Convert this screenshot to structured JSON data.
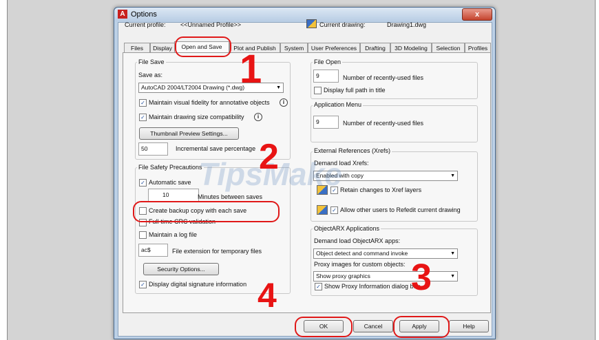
{
  "window": {
    "title": "Options",
    "close": "x"
  },
  "header": {
    "current_profile_label": "Current profile:",
    "current_profile_value": "<<Unnamed Profile>>",
    "current_drawing_label": "Current drawing:",
    "current_drawing_value": "Drawing1.dwg"
  },
  "tabs": [
    {
      "label": "Files"
    },
    {
      "label": "Display"
    },
    {
      "label": "Open and Save"
    },
    {
      "label": "Plot and Publish"
    },
    {
      "label": "System"
    },
    {
      "label": "User Preferences"
    },
    {
      "label": "Drafting"
    },
    {
      "label": "3D Modeling"
    },
    {
      "label": "Selection"
    },
    {
      "label": "Profiles"
    }
  ],
  "file_save": {
    "title": "File Save",
    "save_as_label": "Save as:",
    "save_as_value": "AutoCAD 2004/LT2004 Drawing (*.dwg)",
    "maintain_fidelity": "Maintain visual fidelity for annotative objects",
    "maintain_size": "Maintain drawing size compatibility",
    "thumbnail_button": "Thumbnail Preview Settings...",
    "incremental_value": "50",
    "incremental_label": "Incremental save percentage"
  },
  "file_safety": {
    "title": "File Safety Precautions",
    "automatic_save": "Automatic save",
    "minutes_value": "10",
    "minutes_label": "Minutes between saves",
    "backup_copy": "Create backup copy with each save",
    "crc_validation": "Full-time CRC validation",
    "log_file": "Maintain a log file",
    "ext_value": "ac$",
    "ext_label": "File extension for temporary files",
    "security_button": "Security Options...",
    "digital_signature": "Display digital signature information"
  },
  "file_open": {
    "title": "File Open",
    "recent_value": "9",
    "recent_label": "Number of recently-used files",
    "full_path": "Display full path in title"
  },
  "app_menu": {
    "title": "Application Menu",
    "recent_value": "9",
    "recent_label": "Number of recently-used files"
  },
  "xrefs": {
    "title": "External References (Xrefs)",
    "demand_label": "Demand load Xrefs:",
    "demand_value": "Enabled with copy",
    "retain_changes": "Retain changes to Xref layers",
    "allow_refedit": "Allow other users to Refedit current drawing"
  },
  "objectarx": {
    "title": "ObjectARX Applications",
    "demand_label": "Demand load ObjectARX apps:",
    "demand_value": "Object detect and command invoke",
    "proxy_label": "Proxy images for custom objects:",
    "proxy_value": "Show proxy graphics",
    "proxy_dialog": "Show Proxy Information dialog box"
  },
  "footer": {
    "ok": "OK",
    "cancel": "Cancel",
    "apply": "Apply",
    "help": "Help"
  },
  "annotations": {
    "step1": "1",
    "step2": "2",
    "step3": "3",
    "step4": "4"
  },
  "watermark": "TipsMake",
  "checkmark": "✓",
  "dropdown_arrow": "▼",
  "info_symbol": "i",
  "accent_color": "#e01818"
}
